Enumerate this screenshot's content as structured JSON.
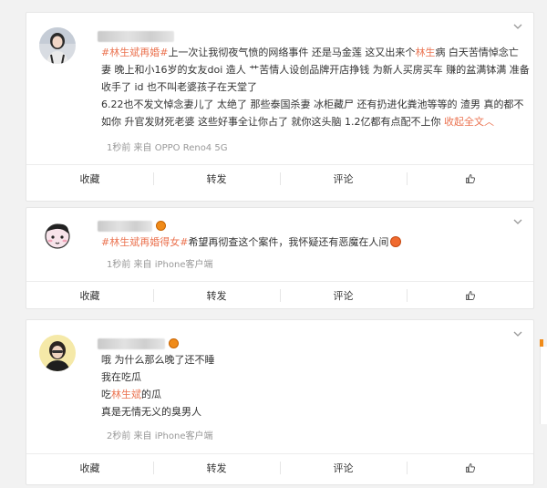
{
  "posts": [
    {
      "content_lines": [
        [
          {
            "t": "#林生斌再婚#",
            "c": "tag"
          },
          {
            "t": "上一次让我彻夜气愤的网络事件 还是马金莲 这又出来个",
            "c": ""
          },
          {
            "t": "林生",
            "c": "hl"
          },
          {
            "t": "病 白天苦情悼念亡",
            "c": ""
          }
        ],
        [
          {
            "t": "妻 晚上和小16岁的女友doi 造人 艹苦情人设创品牌开店挣钱 为新人买房买车 赚的盆满钵满 准备",
            "c": ""
          }
        ],
        [
          {
            "t": "收手了 id 也不叫老婆孩子在天堂了",
            "c": ""
          }
        ],
        [
          {
            "t": "6.22也不发文悼念妻儿了 太绝了 那些泰国杀妻 冰柜藏尸 还有扔进化粪池等等的 渣男 真的都不",
            "c": ""
          }
        ],
        [
          {
            "t": "如你 升官发财死老婆 这些好事全让你占了 就你这头脑 1.2亿都有点配不上你 ",
            "c": ""
          },
          {
            "t": "收起全文",
            "c": "link"
          },
          {
            "t": "︿",
            "c": "link"
          }
        ]
      ],
      "meta": "1秒前  来自 OPPO Reno4 5G"
    },
    {
      "content_lines": [
        [
          {
            "t": "#林生斌再婚得女#",
            "c": "tag"
          },
          {
            "t": "希望再彻查这个案件，我怀疑还有恶魔在人间",
            "c": ""
          }
        ]
      ],
      "meta": "1秒前  来自 iPhone客户端"
    },
    {
      "content_lines": [
        [
          {
            "t": "哦 为什么那么晚了还不睡",
            "c": ""
          }
        ],
        [
          {
            "t": "我在吃瓜",
            "c": ""
          }
        ],
        [
          {
            "t": "吃",
            "c": ""
          },
          {
            "t": "林生斌",
            "c": "hl"
          },
          {
            "t": "的瓜",
            "c": ""
          }
        ],
        [
          {
            "t": "真是无情无义的臭男人",
            "c": ""
          }
        ]
      ],
      "meta": "2秒前  来自 iPhone客户端"
    }
  ],
  "actions": {
    "collect": "收藏",
    "repost": "转发",
    "comment": "评论"
  },
  "colors": {
    "tag": "#eb7350",
    "meta": "#999999"
  }
}
